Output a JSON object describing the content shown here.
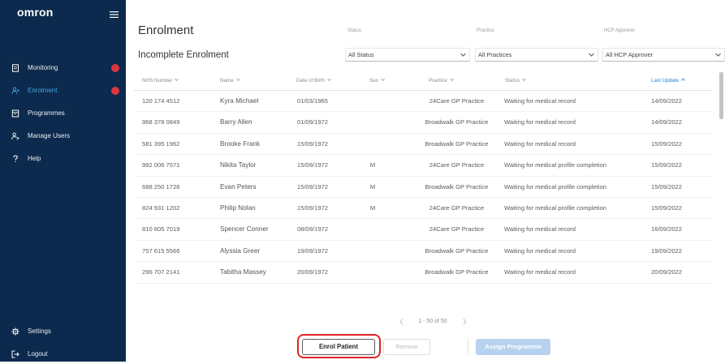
{
  "app": {
    "logo": "omron"
  },
  "colors": {
    "sidebar_bg": "#0c2a4d",
    "active_nav": "#45a3e3",
    "badge": "#d9363e",
    "accent": "#1e7fd8",
    "highlight": "#e02424",
    "assign_button_bg": "#b6d2ee"
  },
  "sidebar": {
    "menu_icon": "hamburger-menu-icon",
    "items": [
      {
        "label": "Monitoring",
        "icon": "monitoring-icon",
        "has_badge": true
      },
      {
        "label": "Enrolment",
        "icon": "enrolment-icon",
        "has_badge": true,
        "active": true
      },
      {
        "label": "Programmes",
        "icon": "programmes-icon"
      },
      {
        "label": "Manage Users",
        "icon": "manage-users-icon"
      },
      {
        "label": "Help",
        "icon": "help-icon"
      }
    ],
    "bottom": [
      {
        "label": "Settings",
        "icon": "gear-icon"
      },
      {
        "label": "Logout",
        "icon": "logout-icon"
      }
    ]
  },
  "header": {
    "title": "Enrolment",
    "subtitle": "Incomplete Enrolment"
  },
  "filters": [
    {
      "label": "Status",
      "value": "All Status"
    },
    {
      "label": "Practice",
      "value": "All Practices"
    },
    {
      "label": "HCP Approver",
      "value": "All HCP Approver"
    }
  ],
  "table": {
    "columns": [
      {
        "label": "NHS Number",
        "sort_icon": "chevron-down-icon"
      },
      {
        "label": "Name",
        "sort_icon": "chevron-down-icon"
      },
      {
        "label": "Date of Birth",
        "sort_icon": "chevron-down-icon"
      },
      {
        "label": "Sex",
        "sort_icon": "chevron-down-icon"
      },
      {
        "label": "Practice",
        "sort_icon": "chevron-down-icon"
      },
      {
        "label": "Status",
        "sort_icon": "chevron-down-icon"
      },
      {
        "label": "Last Update",
        "sort_icon": "chevron-up-icon",
        "sorted": true
      }
    ],
    "rows": [
      {
        "nhs": "120 174 4512",
        "name": "Kyra Michael",
        "dob": "01/03/1965",
        "sex": "",
        "practice": "24Care GP Practice",
        "status": "Waiting for medical record",
        "updated": "14/09/2022"
      },
      {
        "nhs": "968 378 0849",
        "name": "Barry Allen",
        "dob": "01/09/1972",
        "sex": "",
        "practice": "Broadwalk GP Practice",
        "status": "Waiting for medical record",
        "updated": "14/09/2022"
      },
      {
        "nhs": "581 395 1962",
        "name": "Brooke Frank",
        "dob": "15/09/1972",
        "sex": "",
        "practice": "Broadwalk GP Practice",
        "status": "Waiting for medical record",
        "updated": "15/09/2022"
      },
      {
        "nhs": "992 006 7571",
        "name": "Nikita Taylor",
        "dob": "15/09/1972",
        "sex": "M",
        "practice": "24Care GP Practice",
        "status": "Waiting for medical profile completion",
        "updated": "15/09/2022"
      },
      {
        "nhs": "688 250 1726",
        "name": "Evan Peters",
        "dob": "15/09/1972",
        "sex": "M",
        "practice": "Broadwalk GP Practice",
        "status": "Waiting for medical profile completion",
        "updated": "15/09/2022"
      },
      {
        "nhs": "824 931 1202",
        "name": "Philip Nolan",
        "dob": "15/09/1972",
        "sex": "M",
        "practice": "24Care GP Practice",
        "status": "Waiting for medical profile completion",
        "updated": "15/09/2022"
      },
      {
        "nhs": "810 805 7019",
        "name": "Spencer Conner",
        "dob": "08/09/1972",
        "sex": "",
        "practice": "24Care GP Practice",
        "status": "Waiting for medical record",
        "updated": "16/09/2022"
      },
      {
        "nhs": "757 615 5566",
        "name": "Alyssia Greer",
        "dob": "19/09/1972",
        "sex": "",
        "practice": "Broadwalk GP Practice",
        "status": "Waiting for medical record",
        "updated": "19/09/2022"
      },
      {
        "nhs": "296 707 2141",
        "name": "Tabitha Massey",
        "dob": "20/09/1972",
        "sex": "",
        "practice": "Broadwalk GP Practice",
        "status": "Waiting for medical record",
        "updated": "20/09/2022"
      }
    ]
  },
  "pagination": {
    "text": "1 - 50 of 50",
    "prev_icon": "chevron-left-icon",
    "next_icon": "chevron-right-icon"
  },
  "actions": {
    "enrol": "Enrol Patient",
    "remove": "Remove",
    "assign": "Assign Programme"
  }
}
